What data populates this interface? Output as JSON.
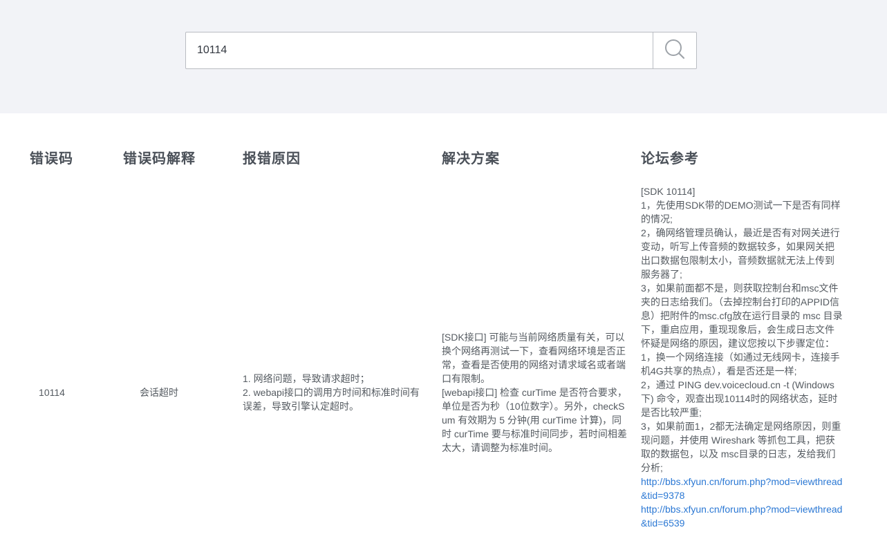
{
  "search": {
    "value": "10114",
    "placeholder": ""
  },
  "table": {
    "headers": {
      "code": "错误码",
      "meaning": "错误码解释",
      "cause": "报错原因",
      "solution": "解决方案",
      "forum": "论坛参考"
    },
    "row": {
      "code": "10114",
      "meaning": "会话超时",
      "cause": [
        "1. 网络问题，导致请求超时；",
        "2. webapi接口的调用方时间和标准时间有误差，导致引擎认定超时。"
      ],
      "solution": [
        "[SDK接口] 可能与当前网络质量有关，可以换个网络再测试一下，查看网络环境是否正常，查看是否使用的网络对请求域名或者端口有限制。",
        "[webapi接口] 检查 curTime 是否符合要求，单位是否为秒（10位数字）。另外，checkSum 有效期为 5 分钟(用 curTime 计算)，同时 curTime 要与标准时间同步，若时间相差太大，请调整为标准时间。"
      ],
      "forum": [
        "[SDK 10114]",
        "1，先使用SDK带的DEMO测试一下是否有同样的情况;",
        "2，确网络管理员确认，最近是否有对网关进行变动，听写上传音频的数据较多，如果网关把出口数据包限制太小，音频数据就无法上传到服务器了;",
        "3，如果前面都不是，则获取控制台和msc文件夹的日志给我们。（去掉控制台打印的APPID信息）把附件的msc.cfg放在运行目录的 msc 目录下，重启应用，重现现象后，会生成日志文件怀疑是网络的原因，建议您按以下步骤定位：",
        "1，换一个网络连接（如通过无线网卡，连接手机4G共享的热点），看是否还是一样;",
        "2，通过 PING dev.voicecloud.cn -t (Windows 下) 命令，观查出现10114时的网络状态，延时是否比较严重;",
        "3，如果前面1，2都无法确定是网络原因，则重现问题，并使用 Wireshark 等抓包工具，把获取的数据包，以及 msc目录的日志，发给我们分析;"
      ],
      "forum_links": [
        "http://bbs.xfyun.cn/forum.php?mod=viewthread&tid=9378",
        "http://bbs.xfyun.cn/forum.php?mod=viewthread&tid=6539"
      ]
    }
  },
  "colors": {
    "band_bg": "#f2f3f7",
    "link": "#2b78d4",
    "header_text": "#4a5058",
    "body_text": "#555b61"
  }
}
